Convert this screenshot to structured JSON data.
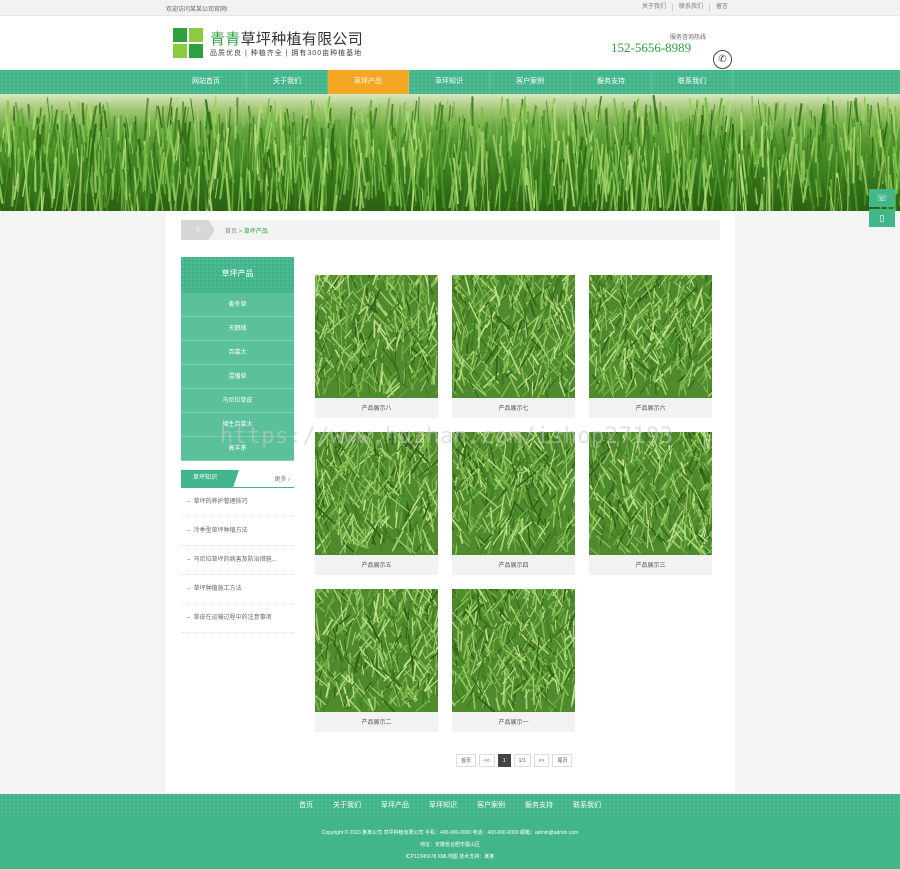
{
  "topbar": {
    "welcome": "欢迎访问某某公司官网!",
    "links": [
      "关于我们",
      "联系我们",
      "留言"
    ]
  },
  "header": {
    "brand_highlight": "青青",
    "brand_rest": "草坪种植有限公司",
    "slogan": "品质优良 | 种植齐全 | 拥有300亩种植基地",
    "hotline_label": "服务咨询热线",
    "hotline": "152-5656-8989"
  },
  "nav": {
    "items": [
      "网站首页",
      "关于我们",
      "草坪产品",
      "草坪知识",
      "客户案例",
      "服务支持",
      "联系我们"
    ],
    "active_index": 2
  },
  "breadcrumb": {
    "home": "首页",
    "sep": " > ",
    "current": "草坪产品"
  },
  "sidebar": {
    "category_title": "草坪产品",
    "categories": [
      "麦冬草",
      "天鹅绒",
      "百慕大",
      "混播草",
      "马尼拉草皮",
      "矮生百慕大",
      "高羊茅"
    ],
    "news_title": "草坪知识",
    "news_more": "更多 ›",
    "news": [
      "草坪的养护管理技巧",
      "冷季型草坪种植方法",
      "马尼拉草坪的病害及防治措施...",
      "草坪种植施工方法",
      "草皮在运输过程中的注意事项"
    ]
  },
  "products": [
    {
      "caption": "产品展示八"
    },
    {
      "caption": "产品展示七"
    },
    {
      "caption": "产品展示六"
    },
    {
      "caption": "产品展示五"
    },
    {
      "caption": "产品展示四"
    },
    {
      "caption": "产品展示三"
    },
    {
      "caption": "产品展示二"
    },
    {
      "caption": "产品展示一"
    }
  ],
  "pager": {
    "first": "首页",
    "prev": "<<",
    "current": "1",
    "total": "1/1",
    "next": ">>",
    "last": "尾页"
  },
  "footer": {
    "nav": [
      "首页",
      "关于我们",
      "草坪产品",
      "草坪知识",
      "客户案例",
      "服务支持",
      "联系我们"
    ],
    "line1": "Copyright © 2023 某某公司 草坪种植有限公司 手机：400-000-0000 电话：400-000-0000 邮箱：admin@admin.com",
    "line2": "地址：安徽省合肥市蜀山区",
    "line3": "ICP12345678 XML地图 技术支持：某某"
  },
  "watermark": "https://www.huzhan.com/ishop27193",
  "colors": {
    "brand_green": "#43b58a",
    "accent_orange": "#f5a623",
    "logo_green": "#2ea042"
  }
}
